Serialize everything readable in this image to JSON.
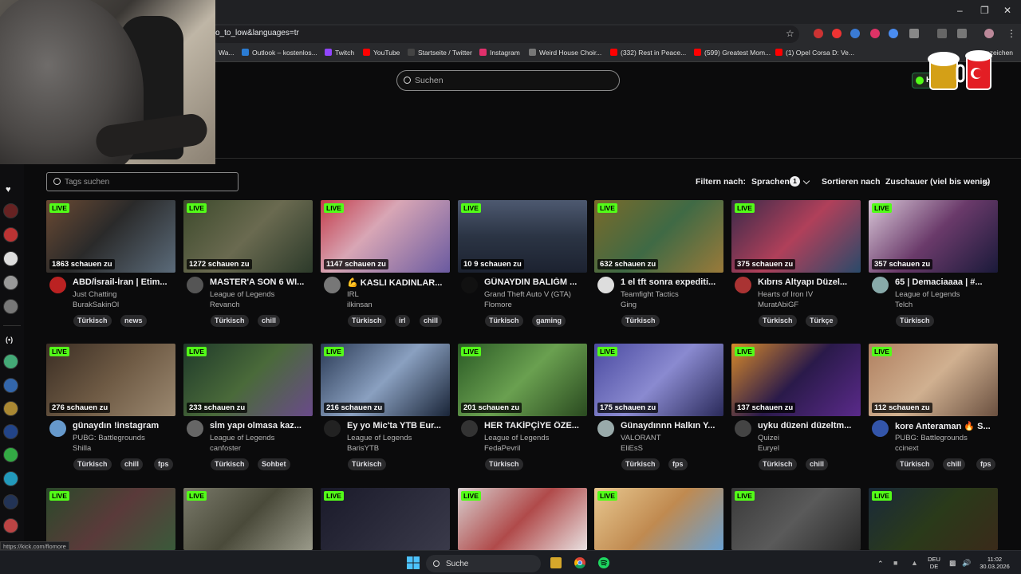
{
  "browser": {
    "url": "o_to_low&languages=tr",
    "bookmarks": [
      {
        "label": "Wa...",
        "color": "#4285f4"
      },
      {
        "label": "Outlook – kostenlos...",
        "color": "#2b7cd3"
      },
      {
        "label": "Twitch",
        "color": "#9146ff"
      },
      {
        "label": "YouTube",
        "color": "#ff0000"
      },
      {
        "label": "Startseite / Twitter",
        "color": "#111111"
      },
      {
        "label": "Instagram",
        "color": "#e1306c"
      },
      {
        "label": "Weird House Choir...",
        "color": "#777777"
      },
      {
        "label": "(332) Rest in Peace...",
        "color": "#ff0000"
      },
      {
        "label": "(599) Greatest Mom...",
        "color": "#ff0000"
      },
      {
        "label": "(1) Opel Corsa D: Ve...",
        "color": "#ff0000"
      }
    ],
    "bookmarks_more": "ezeichen",
    "status_url": "https://kick.com/flomore"
  },
  "header": {
    "search_placeholder": "Suchen",
    "button_label": "H"
  },
  "toolbar": {
    "tag_search_placeholder": "Tags suchen",
    "filter_label": "Filtern nach:",
    "languages_label": "Sprachen",
    "languages_count": "1",
    "sort_label": "Sortieren nach",
    "sort_value": "Zuschauer (viel bis wenig)"
  },
  "live_badge": "LIVE",
  "streams": [
    {
      "viewers": "1863 schauen zu",
      "title": "ABD/İsrail-İran | Etim...",
      "category": "Just Chatting",
      "streamer": "BurakSakinOl",
      "tags": [
        "Türkisch",
        "news"
      ],
      "avatar": "#b22"
    },
    {
      "viewers": "1272 schauen zu",
      "title": "MASTER'A SON 6 WI...",
      "category": "League of Legends",
      "streamer": "Revanch",
      "tags": [
        "Türkisch",
        "chill"
      ],
      "avatar": "#555"
    },
    {
      "viewers": "1147 schauen zu",
      "title": "💪 KASLI KADINLAR...",
      "category": "IRL",
      "streamer": "ilkinsan",
      "tags": [
        "Türkisch",
        "irl",
        "chill"
      ],
      "avatar": "#777"
    },
    {
      "viewers": "10 9 schauen zu",
      "title": "GÜNAYDIN BALIĞM ...",
      "category": "Grand Theft Auto V (GTA)",
      "streamer": "Flomore",
      "tags": [
        "Türkisch",
        "gaming"
      ],
      "avatar": "#111"
    },
    {
      "viewers": "632 schauen zu",
      "title": "1 el tft sonra expediti...",
      "category": "Teamfight Tactics",
      "streamer": "Ging",
      "tags": [
        "Türkisch"
      ],
      "avatar": "#ddd"
    },
    {
      "viewers": "375 schauen zu",
      "title": "Kıbrıs Altyapı Düzel...",
      "category": "Hearts of Iron IV",
      "streamer": "MuratAbiGF",
      "tags": [
        "Türkisch",
        "Türkçe"
      ],
      "avatar": "#a33"
    },
    {
      "viewers": "357 schauen zu",
      "title": "65 | Demaciaaaa | #...",
      "category": "League of Legends",
      "streamer": "Telch",
      "tags": [
        "Türkisch"
      ],
      "avatar": "#8aa"
    },
    {
      "viewers": "276 schauen zu",
      "title": "günaydın !instagram",
      "category": "PUBG: Battlegrounds",
      "streamer": "Shilla",
      "tags": [
        "Türkisch",
        "chill",
        "fps"
      ],
      "avatar": "#69c"
    },
    {
      "viewers": "233 schauen zu",
      "title": "sİm yapı olmasa kaz...",
      "category": "League of Legends",
      "streamer": "canfoster",
      "tags": [
        "Türkisch",
        "Sohbet"
      ],
      "avatar": "#666"
    },
    {
      "viewers": "216 schauen zu",
      "title": "Ey yo Mic'ta YTB Eur...",
      "category": "League of Legends",
      "streamer": "BarisYTB",
      "tags": [
        "Türkisch"
      ],
      "avatar": "#222"
    },
    {
      "viewers": "201 schauen zu",
      "title": "HER TAKİPÇİYE ÖZE...",
      "category": "League of Legends",
      "streamer": "FedaPevril",
      "tags": [
        "Türkisch"
      ],
      "avatar": "#333"
    },
    {
      "viewers": "175 schauen zu",
      "title": "Günaydınnn Halkın Y...",
      "category": "VALORANT",
      "streamer": "EliEsS",
      "tags": [
        "Türkisch",
        "fps"
      ],
      "avatar": "#9aa"
    },
    {
      "viewers": "137 schauen zu",
      "title": "uyku düzeni düzeltm...",
      "category": "Quizei",
      "streamer": "Euryel",
      "tags": [
        "Türkisch",
        "chill"
      ],
      "avatar": "#444"
    },
    {
      "viewers": "112 schauen zu",
      "title": "kore Anteraman 🔥 S...",
      "category": "PUBG: Battlegrounds",
      "streamer": "ccinext",
      "tags": [
        "Türkisch",
        "chill",
        "fps"
      ],
      "avatar": "#35a"
    },
    {
      "viewers": "",
      "title": "",
      "category": "",
      "streamer": "",
      "tags": [],
      "avatar": "#000"
    },
    {
      "viewers": "",
      "title": "",
      "category": "",
      "streamer": "",
      "tags": [],
      "avatar": "#000"
    },
    {
      "viewers": "",
      "title": "",
      "category": "",
      "streamer": "",
      "tags": [],
      "avatar": "#000"
    },
    {
      "viewers": "",
      "title": "",
      "category": "",
      "streamer": "",
      "tags": [],
      "avatar": "#000"
    },
    {
      "viewers": "",
      "title": "",
      "category": "",
      "streamer": "",
      "tags": [],
      "avatar": "#000"
    },
    {
      "viewers": "",
      "title": "",
      "category": "",
      "streamer": "",
      "tags": [],
      "avatar": "#000"
    },
    {
      "viewers": "",
      "title": "",
      "category": "",
      "streamer": "",
      "tags": [],
      "avatar": "#000"
    }
  ],
  "taskbar": {
    "search_label": "Suche",
    "lang_top": "DEU",
    "lang_bottom": "DE",
    "time": "11:02",
    "date": "30.03.2026"
  },
  "colors": {
    "accent": "#53fc18",
    "background": "#0b0b0c"
  }
}
